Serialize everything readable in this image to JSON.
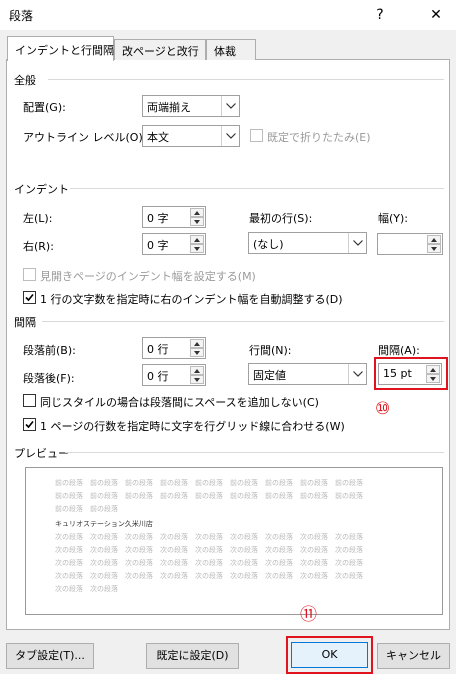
{
  "window": {
    "title": "段落",
    "help_glyph": "?",
    "close_glyph": "✕"
  },
  "tabs": [
    {
      "label": "インデントと行間隔",
      "active": true
    },
    {
      "label": "改ページと改行",
      "active": false
    },
    {
      "label": "体裁",
      "active": false
    }
  ],
  "general": {
    "section": "全般",
    "alignment_label": "配置(G):",
    "alignment_value": "両端揃え",
    "outline_label": "アウトライン レベル(O):",
    "outline_value": "本文",
    "collapse_label": "既定で折りたたみ(E)",
    "collapse_checked": false
  },
  "indent": {
    "section": "インデント",
    "left_label": "左(L):",
    "left_value": "0 字",
    "right_label": "右(R):",
    "right_value": "0 字",
    "first_line_label": "最初の行(S):",
    "first_line_value": "(なし)",
    "width_label": "幅(Y):",
    "width_value": "",
    "mirror_label": "見開きページのインデント幅を設定する(M)",
    "mirror_checked": false,
    "auto_adjust_label": "1 行の文字数を指定時に右のインデント幅を自動調整する(D)",
    "auto_adjust_checked": true
  },
  "spacing": {
    "section": "間隔",
    "before_label": "段落前(B):",
    "before_value": "0 行",
    "after_label": "段落後(F):",
    "after_value": "0 行",
    "line_spacing_label": "行間(N):",
    "line_spacing_value": "固定値",
    "at_label": "間隔(A):",
    "at_value": "15 pt",
    "no_space_same_style_label": "同じスタイルの場合は段落間にスペースを追加しない(C)",
    "no_space_same_style_checked": false,
    "snap_to_grid_label": "1 ページの行数を指定時に文字を行グリッド線に合わせる(W)",
    "snap_to_grid_checked": true
  },
  "annotations": {
    "marker_10": "⑩",
    "marker_11": "⑪",
    "highlight_color": "#e0141e"
  },
  "preview": {
    "section": "プレビュー",
    "prev_lines": [
      "前の段落　前の段落　前の段落　前の段落　前の段落　前の段落　前の段落　前の段落　前の段落",
      "前の段落　前の段落　前の段落　前の段落　前の段落　前の段落　前の段落　前の段落　前の段落",
      "前の段落　前の段落"
    ],
    "sample_text": "キュリオステーション久米川店",
    "next_lines": [
      "次の段落　次の段落　次の段落　次の段落　次の段落　次の段落　次の段落　次の段落　次の段落",
      "次の段落　次の段落　次の段落　次の段落　次の段落　次の段落　次の段落　次の段落　次の段落",
      "次の段落　次の段落　次の段落　次の段落　次の段落　次の段落　次の段落　次の段落　次の段落",
      "次の段落　次の段落　次の段落　次の段落　次の段落　次の段落　次の段落　次の段落　次の段落",
      "次の段落　次の段落"
    ]
  },
  "buttons": {
    "tabs": "タブ設定(T)...",
    "set_default": "既定に設定(D)",
    "ok": "OK",
    "cancel": "キャンセル"
  }
}
